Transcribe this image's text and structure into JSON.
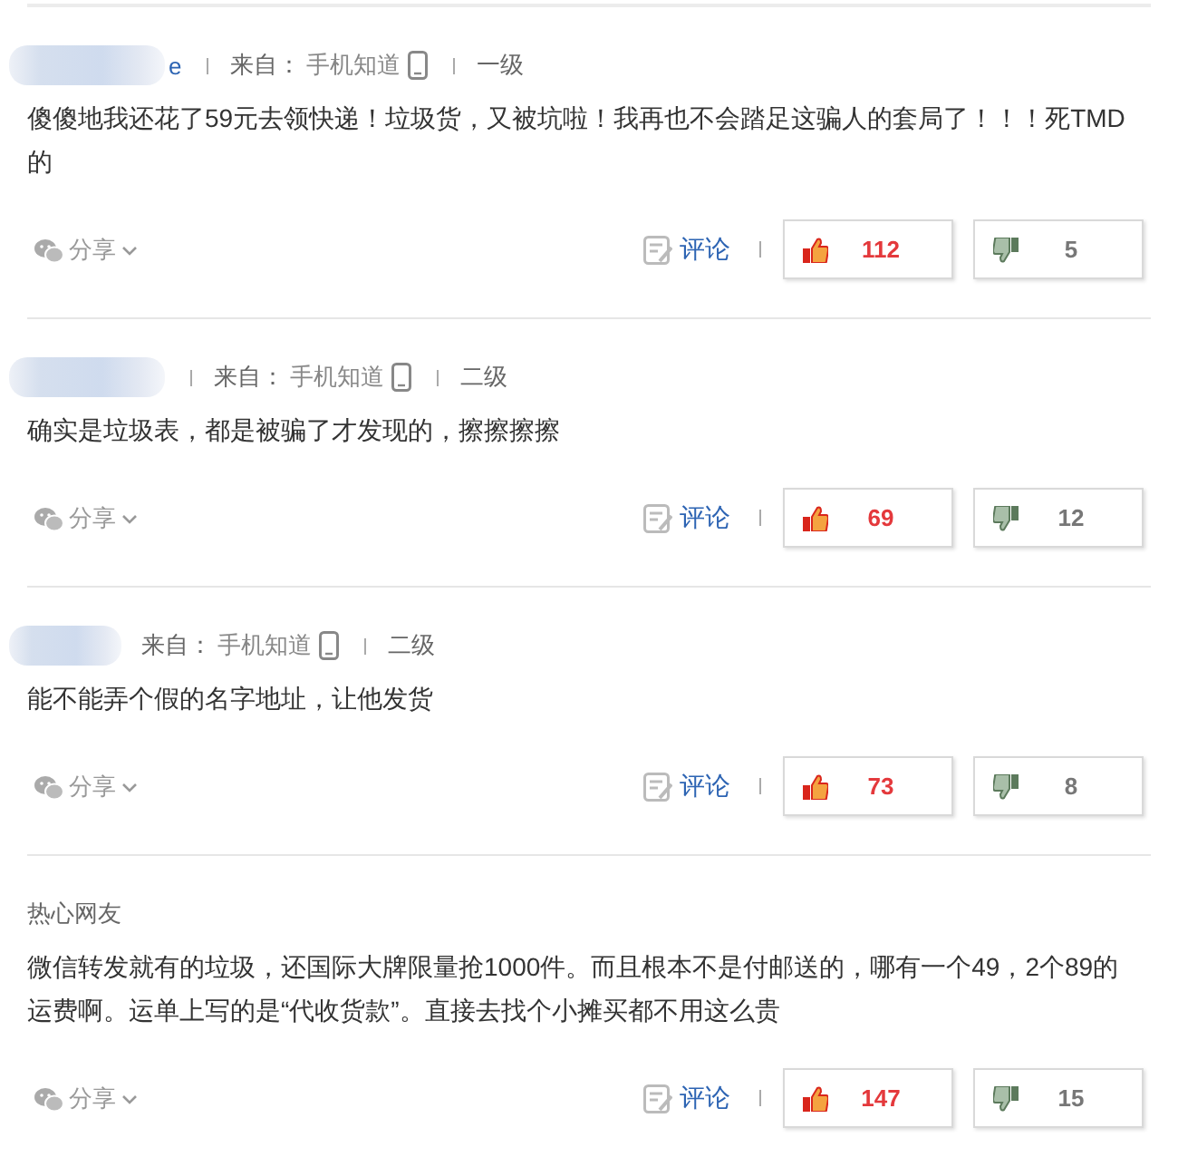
{
  "comments": [
    {
      "author": {
        "kind": "redacted",
        "visible_text": "e",
        "separator": true
      },
      "source_label": "来自：",
      "source": "手机知道",
      "level": "一级",
      "body": "傻傻地我还花了59元去领快递！垃圾货，又被坑啦！我再也不会踏足这骗人的套局了！！！死TMD的",
      "actions": {
        "share": "分享",
        "comment": "评论",
        "likes": "112",
        "dislikes": "5"
      }
    },
    {
      "author": {
        "kind": "redacted",
        "separator": true
      },
      "source_label": "来自：",
      "source": "手机知道",
      "level": "二级",
      "body": "确实是垃圾表，都是被骗了才发现的，擦擦擦擦",
      "actions": {
        "share": "分享",
        "comment": "评论",
        "likes": "69",
        "dislikes": "12"
      }
    },
    {
      "author": {
        "kind": "redacted",
        "separator": false
      },
      "source_label": "来自：",
      "source": "手机知道",
      "level": "二级",
      "body": "能不能弄个假的名字地址，让他发货",
      "actions": {
        "share": "分享",
        "comment": "评论",
        "likes": "73",
        "dislikes": "8"
      }
    },
    {
      "author": {
        "kind": "name",
        "text": "热心网友"
      },
      "body": "微信转发就有的垃圾，还国际大牌限量抢1000件。而且根本不是付邮送的，哪有一个49，2个89的运费啊。运单上写的是“代收货款”。直接去找个小摊买都不用这么贵",
      "actions": {
        "share": "分享",
        "comment": "评论",
        "likes": "147",
        "dislikes": "15"
      }
    }
  ]
}
